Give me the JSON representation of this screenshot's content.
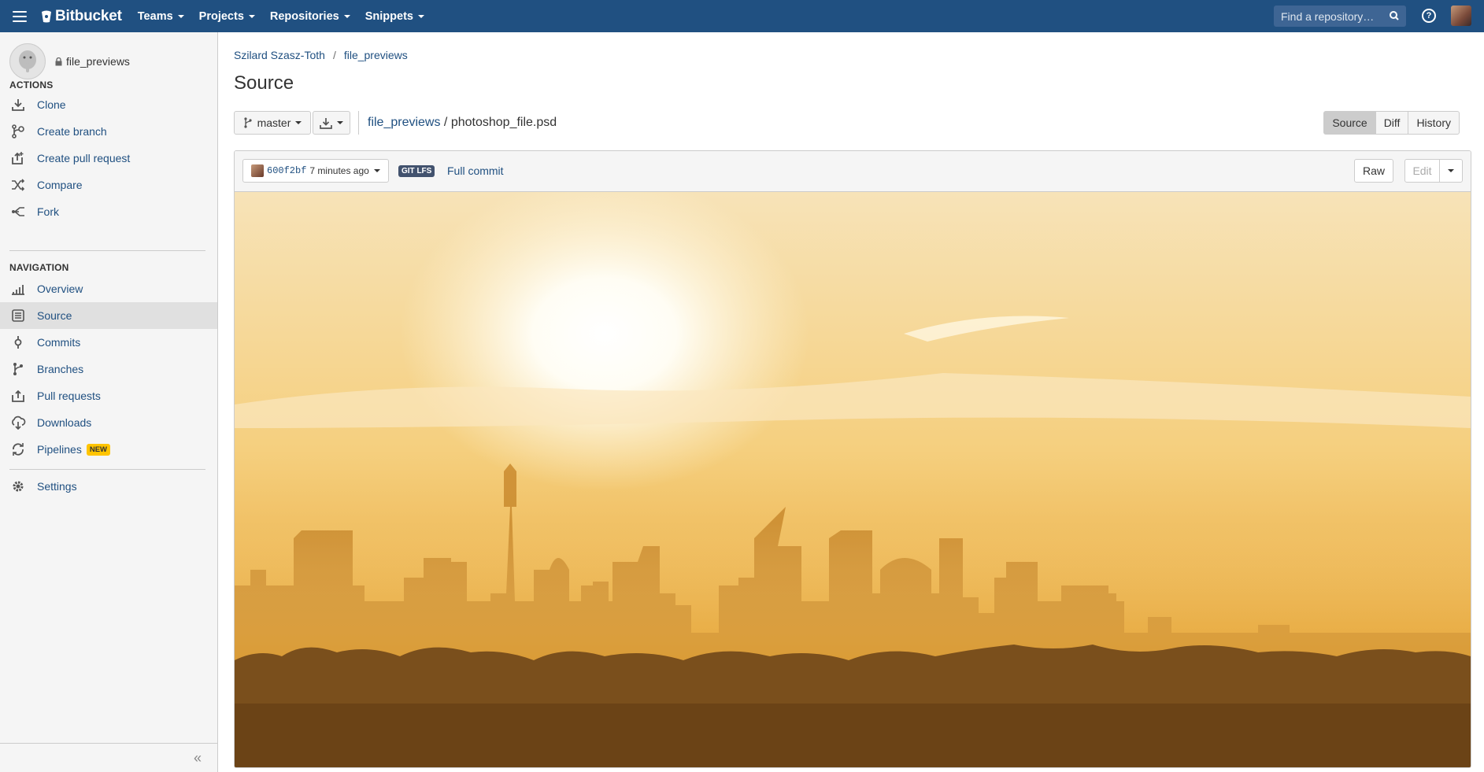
{
  "topbar": {
    "brand": "Bitbucket",
    "nav": [
      "Teams",
      "Projects",
      "Repositories",
      "Snippets"
    ],
    "search_placeholder": "Find a repository…"
  },
  "sidebar": {
    "repo_name": "file_previews",
    "actions_title": "ACTIONS",
    "actions": [
      {
        "label": "Clone",
        "icon": "clone-icon"
      },
      {
        "label": "Create branch",
        "icon": "create-branch-icon"
      },
      {
        "label": "Create pull request",
        "icon": "create-pull-request-icon"
      },
      {
        "label": "Compare",
        "icon": "compare-icon"
      },
      {
        "label": "Fork",
        "icon": "fork-icon"
      }
    ],
    "navigation_title": "NAVIGATION",
    "navigation": [
      {
        "label": "Overview",
        "icon": "overview-icon"
      },
      {
        "label": "Source",
        "icon": "source-icon",
        "active": true
      },
      {
        "label": "Commits",
        "icon": "commits-icon"
      },
      {
        "label": "Branches",
        "icon": "branches-icon"
      },
      {
        "label": "Pull requests",
        "icon": "pull-requests-icon"
      },
      {
        "label": "Downloads",
        "icon": "downloads-icon"
      },
      {
        "label": "Pipelines",
        "icon": "pipelines-icon",
        "badge": "NEW"
      }
    ],
    "settings": {
      "label": "Settings",
      "icon": "gear-icon"
    },
    "collapse_glyph": "«"
  },
  "main": {
    "breadcrumb": {
      "owner": "Szilard Szasz-Toth",
      "separator": "/",
      "repo": "file_previews"
    },
    "title": "Source",
    "branch": "master",
    "path": {
      "dir": "file_previews",
      "separator": " / ",
      "file": "photoshop_file.psd"
    },
    "view_tabs": [
      "Source",
      "Diff",
      "History"
    ],
    "active_tab": "Source"
  },
  "file": {
    "commit_hash": "600f2bf",
    "commit_age": "7 minutes ago",
    "lfs_badge": "GIT LFS",
    "full_commit": "Full commit",
    "raw": "Raw",
    "edit": "Edit"
  },
  "colors": {
    "header": "#205081",
    "link": "#205081",
    "badge_new": "#ffc400",
    "lfs": "#42526e"
  }
}
